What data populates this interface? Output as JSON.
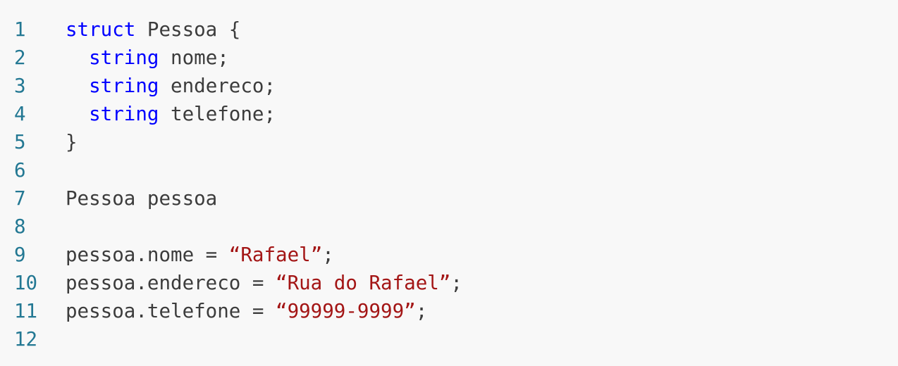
{
  "colors": {
    "background": "#f8f8f8",
    "line_number": "#237893",
    "keyword": "#0000ff",
    "string": "#a31515",
    "text": "#3c3c3c"
  },
  "lines": [
    {
      "number": "1",
      "tokens": [
        {
          "type": "kw",
          "text": "struct"
        },
        {
          "type": "plain",
          "text": " Pessoa {"
        }
      ]
    },
    {
      "number": "2",
      "tokens": [
        {
          "type": "plain",
          "text": "  "
        },
        {
          "type": "kw",
          "text": "string"
        },
        {
          "type": "plain",
          "text": " nome;"
        }
      ]
    },
    {
      "number": "3",
      "tokens": [
        {
          "type": "plain",
          "text": "  "
        },
        {
          "type": "kw",
          "text": "string"
        },
        {
          "type": "plain",
          "text": " endereco;"
        }
      ]
    },
    {
      "number": "4",
      "tokens": [
        {
          "type": "plain",
          "text": "  "
        },
        {
          "type": "kw",
          "text": "string"
        },
        {
          "type": "plain",
          "text": " telefone;"
        }
      ]
    },
    {
      "number": "5",
      "tokens": [
        {
          "type": "plain",
          "text": "}"
        }
      ]
    },
    {
      "number": "6",
      "tokens": []
    },
    {
      "number": "7",
      "tokens": [
        {
          "type": "plain",
          "text": "Pessoa pessoa"
        }
      ]
    },
    {
      "number": "8",
      "tokens": []
    },
    {
      "number": "9",
      "tokens": [
        {
          "type": "plain",
          "text": "pessoa.nome = "
        },
        {
          "type": "str",
          "text": "“Rafael”"
        },
        {
          "type": "plain",
          "text": ";"
        }
      ]
    },
    {
      "number": "10",
      "tokens": [
        {
          "type": "plain",
          "text": "pessoa.endereco = "
        },
        {
          "type": "str",
          "text": "“Rua do Rafael”"
        },
        {
          "type": "plain",
          "text": ";"
        }
      ]
    },
    {
      "number": "11",
      "tokens": [
        {
          "type": "plain",
          "text": "pessoa.telefone = "
        },
        {
          "type": "str",
          "text": "“99999-9999”"
        },
        {
          "type": "plain",
          "text": ";"
        }
      ]
    },
    {
      "number": "12",
      "tokens": []
    }
  ]
}
